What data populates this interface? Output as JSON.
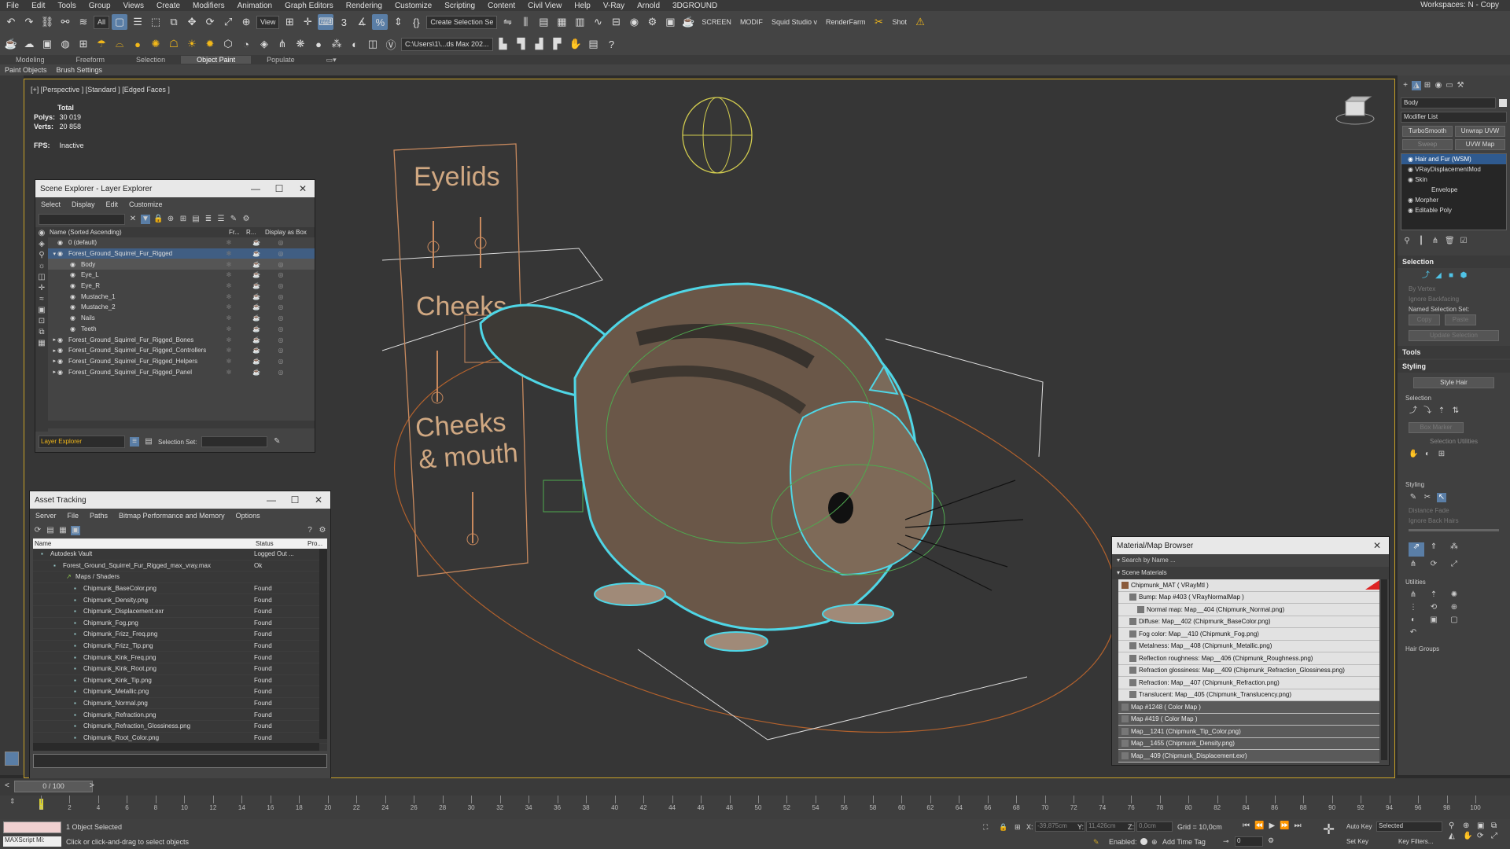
{
  "menu": [
    "File",
    "Edit",
    "Tools",
    "Group",
    "Views",
    "Create",
    "Modifiers",
    "Animation",
    "Graph Editors",
    "Rendering",
    "Customize",
    "Scripting",
    "Content",
    "Civil View",
    "Help",
    "V-Ray",
    "Arnold",
    "3DGROUND"
  ],
  "workspaces": "Workspaces:  N - Copy",
  "toolbar": {
    "filter": "All",
    "refcoord": "View",
    "selset": "Create Selection Se",
    "labels": [
      "SCREEN",
      "MODIF",
      "Squid Studio v",
      "RenderFarm",
      "Shot"
    ],
    "path": "C:\\Users\\1\\...ds Max 202..."
  },
  "ribbon_tabs": [
    "Modeling",
    "Freeform",
    "Selection",
    "Object Paint",
    "Populate"
  ],
  "ribbon_active": "Object Paint",
  "subtabs": [
    "Paint Objects",
    "Brush Settings"
  ],
  "viewport": {
    "label": "[+] [Perspective ] [Standard ] [Edged Faces ]",
    "stats_title": "Total",
    "polys_label": "Polys:",
    "polys": "30 019",
    "verts_label": "Verts:",
    "verts": "20 858",
    "fps_label": "FPS:",
    "fps": "Inactive",
    "panel_texts": [
      "Eyelids",
      "Cheeks",
      "Cheeks",
      "& mouth"
    ]
  },
  "layer_explorer": {
    "title": "Scene Explorer - Layer Explorer",
    "menu": [
      "Select",
      "Display",
      "Edit",
      "Customize"
    ],
    "col_name": "Name (Sorted Ascending)",
    "col_fr": "Fr...",
    "col_r": "R...",
    "col_box": "Display as Box",
    "rows": [
      {
        "label": "0 (default)",
        "indent": 1
      },
      {
        "label": "Forest_Ground_Squirrel_Fur_Rigged",
        "indent": 1,
        "hi": true
      },
      {
        "label": "Body",
        "indent": 2,
        "sel": true
      },
      {
        "label": "Eye_L",
        "indent": 2
      },
      {
        "label": "Eye_R",
        "indent": 2
      },
      {
        "label": "Mustache_1",
        "indent": 2
      },
      {
        "label": "Mustache_2",
        "indent": 2
      },
      {
        "label": "Nails",
        "indent": 2
      },
      {
        "label": "Teeth",
        "indent": 2
      },
      {
        "label": "Forest_Ground_Squirrel_Fur_Rigged_Bones",
        "indent": 1
      },
      {
        "label": "Forest_Ground_Squirrel_Fur_Rigged_Controllers",
        "indent": 1
      },
      {
        "label": "Forest_Ground_Squirrel_Fur_Rigged_Helpers",
        "indent": 1
      },
      {
        "label": "Forest_Ground_Squirrel_Fur_Rigged_Panel",
        "indent": 1
      }
    ],
    "footer_mode": "Layer Explorer",
    "footer_selset": "Selection Set:"
  },
  "asset_tracking": {
    "title": "Asset Tracking",
    "menu": [
      "Server",
      "File",
      "Paths",
      "Bitmap Performance and Memory",
      "Options"
    ],
    "col_name": "Name",
    "col_status": "Status",
    "col_pro": "Pro...",
    "rows": [
      {
        "name": "Autodesk Vault",
        "status": "Logged Out ...",
        "indent": 1
      },
      {
        "name": "Forest_Ground_Squirrel_Fur_Rigged_max_vray.max",
        "status": "Ok",
        "indent": 2
      },
      {
        "name": "Maps / Shaders",
        "status": "",
        "indent": 3
      },
      {
        "name": "Chipmunk_BaseColor.png",
        "status": "Found",
        "indent": 4
      },
      {
        "name": "Chipmunk_Density.png",
        "status": "Found",
        "indent": 4
      },
      {
        "name": "Chipmunk_Displacement.exr",
        "status": "Found",
        "indent": 4
      },
      {
        "name": "Chipmunk_Fog.png",
        "status": "Found",
        "indent": 4
      },
      {
        "name": "Chipmunk_Frizz_Freq.png",
        "status": "Found",
        "indent": 4
      },
      {
        "name": "Chipmunk_Frizz_Tip.png",
        "status": "Found",
        "indent": 4
      },
      {
        "name": "Chipmunk_Kink_Freq.png",
        "status": "Found",
        "indent": 4
      },
      {
        "name": "Chipmunk_Kink_Root.png",
        "status": "Found",
        "indent": 4
      },
      {
        "name": "Chipmunk_Kink_Tip.png",
        "status": "Found",
        "indent": 4
      },
      {
        "name": "Chipmunk_Metallic.png",
        "status": "Found",
        "indent": 4
      },
      {
        "name": "Chipmunk_Normal.png",
        "status": "Found",
        "indent": 4
      },
      {
        "name": "Chipmunk_Refraction.png",
        "status": "Found",
        "indent": 4
      },
      {
        "name": "Chipmunk_Refraction_Glossiness.png",
        "status": "Found",
        "indent": 4
      },
      {
        "name": "Chipmunk_Root_Color.png",
        "status": "Found",
        "indent": 4
      }
    ]
  },
  "material_browser": {
    "title": "Material/Map Browser",
    "search": "Search by Name ...",
    "group": "Scene Materials",
    "rows": [
      {
        "label": "Chipmunk_MAT  ( VRayMtl )",
        "indent": 1
      },
      {
        "label": "Bump: Map #403  ( VRayNormalMap )",
        "indent": 2
      },
      {
        "label": "Normal map: Map__404 (Chipmunk_Normal.png)",
        "indent": 3
      },
      {
        "label": "Diffuse: Map__402 (Chipmunk_BaseColor.png)",
        "indent": 2
      },
      {
        "label": "Fog color: Map__410 (Chipmunk_Fog.png)",
        "indent": 2
      },
      {
        "label": "Metalness: Map__408 (Chipmunk_Metallic.png)",
        "indent": 2
      },
      {
        "label": "Reflection roughness: Map__406 (Chipmunk_Roughness.png)",
        "indent": 2
      },
      {
        "label": "Refraction glossiness: Map__409 (Chipmunk_Refraction_Glossiness.png)",
        "indent": 2
      },
      {
        "label": "Refraction: Map__407 (Chipmunk_Refraction.png)",
        "indent": 2
      },
      {
        "label": "Translucent: Map__405 (Chipmunk_Translucency.png)",
        "indent": 2
      },
      {
        "label": "Map #1248  ( Color Map )",
        "indent": 1,
        "dark": true
      },
      {
        "label": "Map #419  ( Color Map )",
        "indent": 1,
        "dark": true
      },
      {
        "label": "Map__1241 (Chipmunk_Tip_Color.png)",
        "indent": 1,
        "dark": true
      },
      {
        "label": "Map__1455 (Chipmunk_Density.png)",
        "indent": 1,
        "dark": true
      },
      {
        "label": "Map__409 (Chipmunk_Displacement.exr)",
        "indent": 1,
        "dark": true
      }
    ]
  },
  "command_panel": {
    "object_name": "Body",
    "modifier_list": "Modifier List",
    "buttons": [
      "TurboSmooth",
      "Unwrap UVW",
      "Sweep",
      "UVW Map"
    ],
    "stack": [
      {
        "label": "Hair and Fur (WSM)",
        "sel": true
      },
      {
        "label": "VRayDisplacementMod"
      },
      {
        "label": "Skin"
      },
      {
        "label": "Envelope",
        "indent": true
      },
      {
        "label": "Morpher"
      },
      {
        "label": "Editable Poly"
      }
    ],
    "selection_hdr": "Selection",
    "by_vertex": "By Vertex",
    "ignore_backfacing": "Ignore Backfacing",
    "named_sel": "Named Selection Set:",
    "copy": "Copy",
    "paste": "Paste",
    "update_sel": "Update Selection",
    "tools_hdr": "Tools",
    "styling_hdr": "Styling",
    "style_hair": "Style Hair",
    "selection_sub": "Selection",
    "box_marker": "Box Marker",
    "selection_utilities": "Selection Utilities",
    "styling_sub": "Styling",
    "distance_fade": "Distance Fade",
    "ignore_back_hairs": "Ignore Back Hairs",
    "utilities": "Utilities",
    "hair_groups": "Hair Groups"
  },
  "timeline": {
    "frame": "0 / 100",
    "ticks": [
      "0",
      "2",
      "4",
      "6",
      "8",
      "10",
      "12",
      "14",
      "16",
      "18",
      "20",
      "22",
      "24",
      "26",
      "28",
      "30",
      "32",
      "34",
      "36",
      "38",
      "40",
      "42",
      "44",
      "46",
      "48",
      "50",
      "52",
      "54",
      "56",
      "58",
      "60",
      "62",
      "64",
      "66",
      "68",
      "70",
      "72",
      "74",
      "76",
      "78",
      "80",
      "82",
      "84",
      "86",
      "88",
      "90",
      "92",
      "94",
      "96",
      "98",
      "100"
    ]
  },
  "status": {
    "maxscript": "MAXScript Mi:",
    "selected": "1 Object Selected",
    "hint": "Click or click-and-drag to select objects",
    "x_label": "X:",
    "x": "-39,875cm",
    "y_label": "Y:",
    "y": "11,426cm",
    "z_label": "Z:",
    "z": "0,0cm",
    "grid": "Grid = 10,0cm",
    "enabled": "Enabled:",
    "add_time_tag": "Add Time Tag",
    "autokey": "Auto Key",
    "setkey": "Set Key",
    "selected_dd": "Selected",
    "key_filters": "Key Filters...",
    "frame_field": "0"
  }
}
